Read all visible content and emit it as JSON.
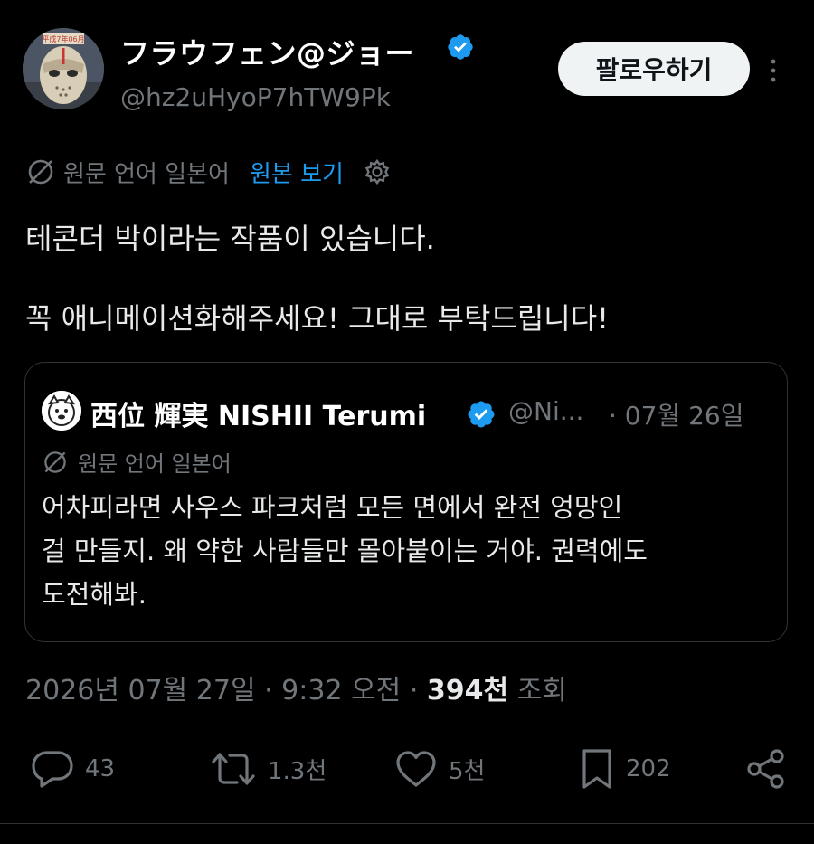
{
  "author": {
    "display_name": "フラウフェン@ジョー",
    "handle": "@hz2uHyoP7hTW9Pk",
    "avatar_badge_text": "平成7年06月",
    "verified": true
  },
  "follow_button": {
    "label": "팔로우하기"
  },
  "translation": {
    "source_language": "원문 언어 일본어",
    "view_original": "원본 보기"
  },
  "tweet": {
    "lines": [
      "테콘더 박이라는 작품이 있습니다.",
      "꼭 애니메이션화해주세요! 그대로 부탁드립니다!"
    ]
  },
  "quote": {
    "display_name": "西位 輝実 NISHII Terumi",
    "handle": "@Ni...",
    "date": "· 07월 26일",
    "source_language": "원문 언어 일본어",
    "lines": [
      "어차피라면 사우스 파크처럼 모든 면에서 완전 엉망인",
      "걸 만들지. 왜 약한 사람들만 몰아붙이는 거야. 권력에도",
      "도전해봐."
    ]
  },
  "meta": {
    "date_time": "2026년 07월 27일 · 9:32 오전 ·",
    "views_count": "394천",
    "views_label": "조회"
  },
  "actions": {
    "replies": "43",
    "reposts": "1.3천",
    "likes": "5천",
    "bookmarks": "202"
  },
  "colors": {
    "background": "#000000",
    "text": "#e7e9ea",
    "secondary_text": "#71767b",
    "accent": "#1d9bf0",
    "verified": "#1d9bf0",
    "border": "#2f3336",
    "follow_button_bg": "#eff3f4"
  },
  "icons": {
    "verified": "verified-badge-icon",
    "more": "more-vertical-icon",
    "translation": "globe-slash-icon",
    "settings": "gear-icon",
    "reply": "speech-bubble-icon",
    "repost": "repost-arrows-icon",
    "like": "heart-icon",
    "bookmark": "bookmark-icon",
    "share": "share-icon"
  }
}
